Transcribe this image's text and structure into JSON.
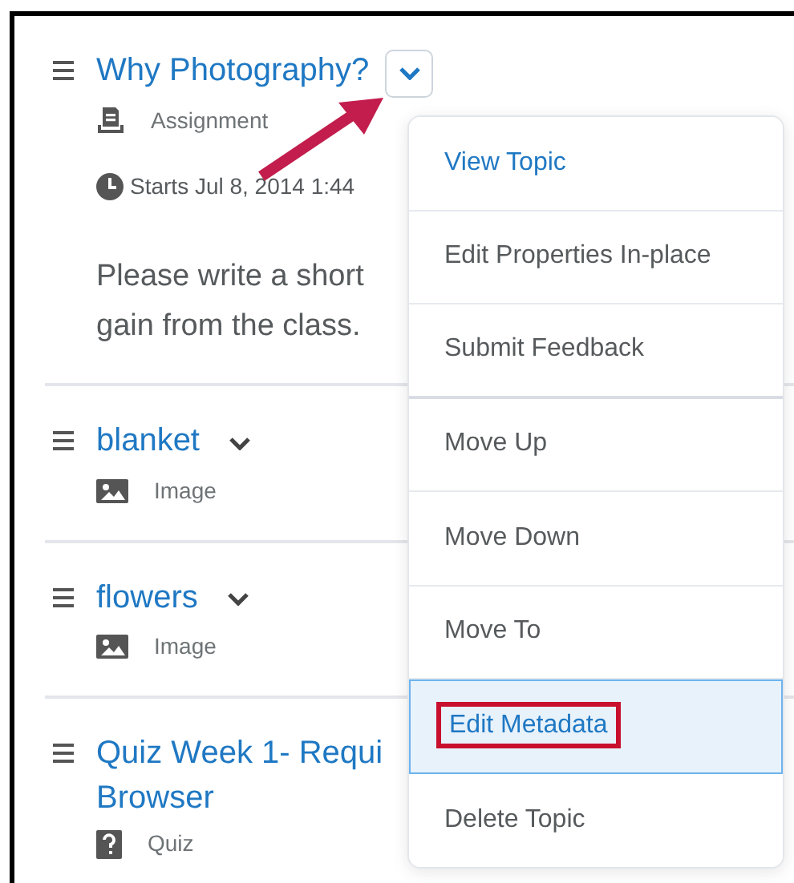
{
  "items": [
    {
      "title": "Why Photography?",
      "type": "Assignment",
      "kind": "assignment",
      "menu_open": true,
      "starts": "Starts Jul 8, 2014 1:44",
      "description": [
        "Please write a short",
        "gain from the class."
      ]
    },
    {
      "title": "blanket",
      "type": "Image",
      "kind": "image",
      "menu_open": false
    },
    {
      "title": "flowers",
      "type": "Image",
      "kind": "image",
      "menu_open": false
    },
    {
      "title": "Quiz Week 1- Requi",
      "title_line2": "Browser",
      "type": "Quiz",
      "kind": "quiz"
    }
  ],
  "menu": [
    {
      "label": "View Topic",
      "kind": "primary",
      "selected": false,
      "annotated": false
    },
    {
      "label": "Edit Properties In-place",
      "kind": "normal",
      "selected": false,
      "annotated": false
    },
    {
      "label": "Submit Feedback",
      "kind": "normal",
      "selected": false,
      "annotated": false,
      "group_end": true
    },
    {
      "label": "Move Up",
      "kind": "normal",
      "selected": false,
      "annotated": false
    },
    {
      "label": "Move Down",
      "kind": "normal",
      "selected": false,
      "annotated": false
    },
    {
      "label": "Move To",
      "kind": "normal",
      "selected": false,
      "annotated": false
    },
    {
      "label": "Edit Metadata",
      "kind": "normal",
      "selected": true,
      "annotated": true
    },
    {
      "label": "Delete Topic",
      "kind": "normal",
      "selected": false,
      "annotated": false
    }
  ]
}
